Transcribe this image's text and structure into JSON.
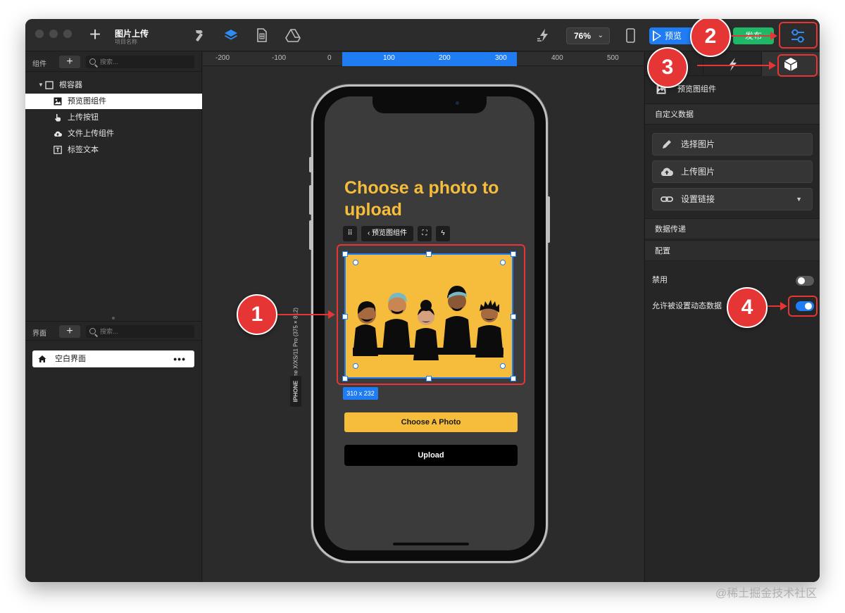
{
  "project": {
    "title": "图片上传",
    "subtitle": "项目名称"
  },
  "toolbar": {
    "zoom": "76%",
    "preview_label": "预览",
    "publish_label": "发布"
  },
  "components_panel": {
    "label": "组件",
    "search_placeholder": "搜索...",
    "tree": [
      {
        "label": "根容器",
        "icon": "checkbox-frame-icon"
      },
      {
        "label": "预览图组件",
        "icon": "image-icon",
        "selected": true
      },
      {
        "label": "上传按钮",
        "icon": "hand-pointer-icon"
      },
      {
        "label": "文件上传组件",
        "icon": "cloud-upload-icon"
      },
      {
        "label": "标签文本",
        "icon": "text-t-icon"
      }
    ]
  },
  "screens_panel": {
    "label": "界面",
    "search_placeholder": "搜索...",
    "items": [
      {
        "label": "空白界面",
        "more": "•••"
      }
    ]
  },
  "ruler": {
    "ticks": [
      "-200",
      "-100",
      "0",
      "100",
      "200",
      "300",
      "400",
      "500"
    ]
  },
  "device": {
    "label": "iPhone X/XS/11 Pro (375 × 812)",
    "type": "IPHONE"
  },
  "screen": {
    "title": "Choose a photo to upload",
    "component_toolbar_label": "预览图组件",
    "size_tag": "310 x 232",
    "choose_button": "Choose A Photo",
    "upload_button": "Upload"
  },
  "inspector": {
    "component_name": "预览图组件",
    "custom_data_label": "自定义数据",
    "actions": [
      {
        "label": "选择图片",
        "icon": "pencil-icon"
      },
      {
        "label": "上传图片",
        "icon": "cloud-upload-icon"
      },
      {
        "label": "设置链接",
        "icon": "link-icon",
        "dropdown": "▼"
      }
    ],
    "data_transfer_label": "数据传递",
    "config_label": "配置",
    "disabled_label": "禁用",
    "disabled_value": false,
    "dynamic_label": "允许被设置动态数据",
    "dynamic_value": true
  },
  "annotations": [
    "1",
    "2",
    "3",
    "4"
  ],
  "colors": {
    "accent": "#1f7cf2",
    "brand_yellow": "#f6bd3c",
    "publish_green": "#1fb866",
    "annotation_red": "#e63535"
  },
  "watermark": "@稀土掘金技术社区"
}
